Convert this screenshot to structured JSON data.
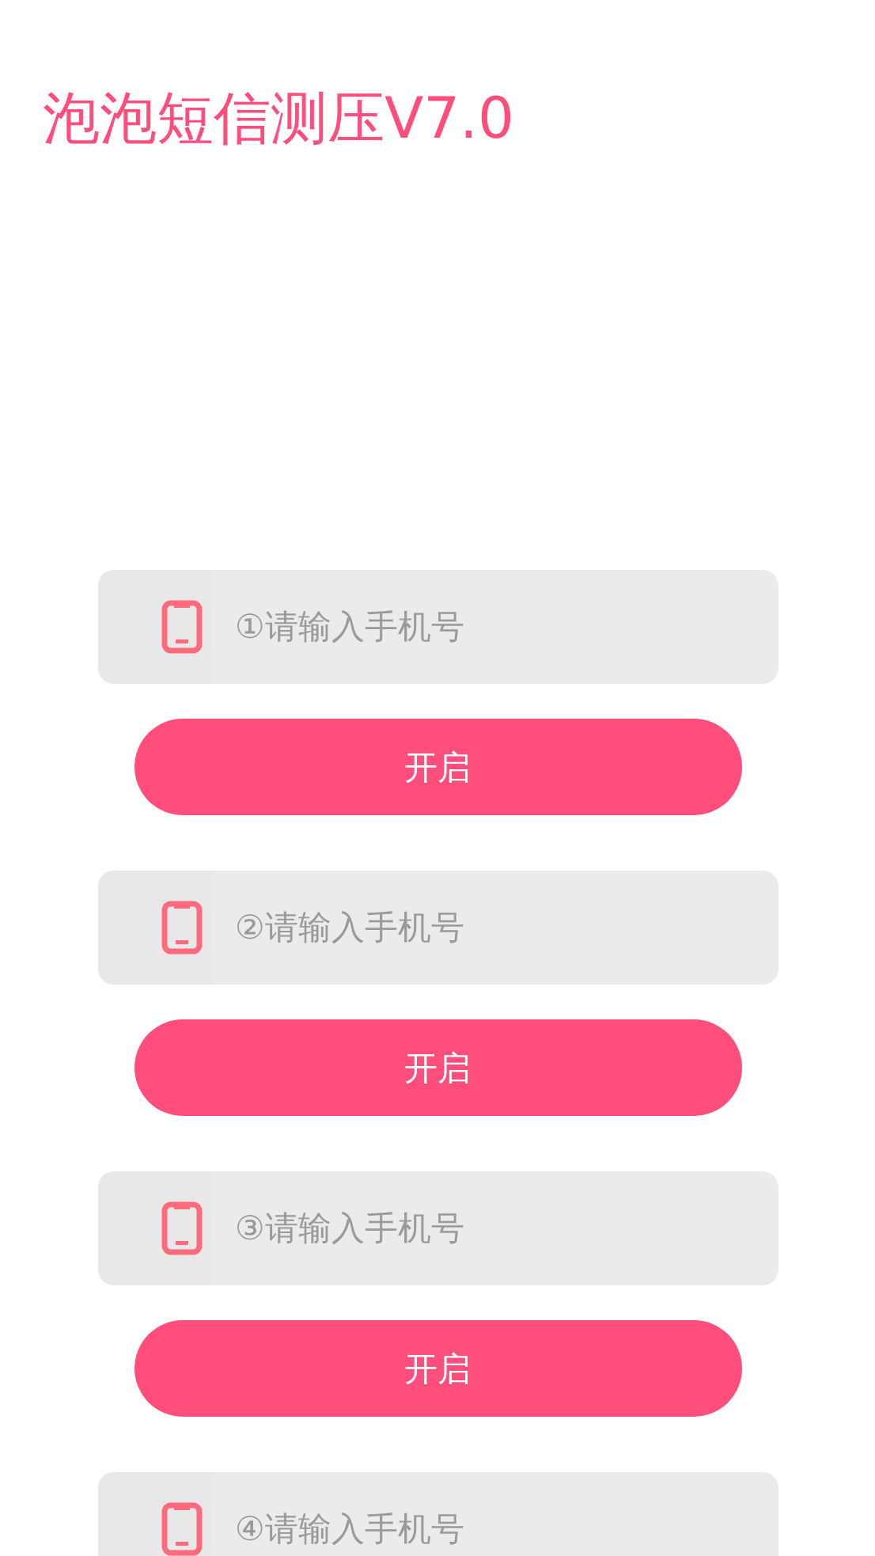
{
  "title": "泡泡短信测压V7.0",
  "groups": [
    {
      "placeholder": "①请输入手机号",
      "button": "开启"
    },
    {
      "placeholder": "②请输入手机号",
      "button": "开启"
    },
    {
      "placeholder": "③请输入手机号",
      "button": "开启"
    },
    {
      "placeholder": "④请输入手机号"
    }
  ]
}
